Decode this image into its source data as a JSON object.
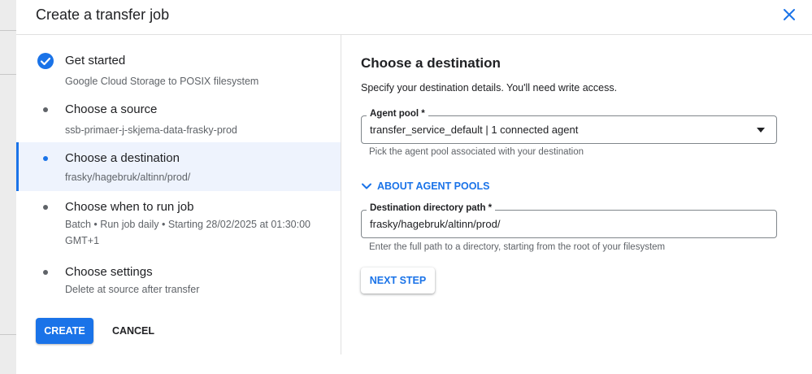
{
  "dialog": {
    "title": "Create a transfer job"
  },
  "steps": [
    {
      "title": "Get started",
      "subtitle": "Google Cloud Storage to POSIX filesystem",
      "state": "completed"
    },
    {
      "title": "Choose a source",
      "subtitle": "ssb-primaer-j-skjema-data-frasky-prod",
      "state": "pending"
    },
    {
      "title": "Choose a destination",
      "subtitle": "frasky/hagebruk/altinn/prod/",
      "state": "active"
    },
    {
      "title": "Choose when to run job",
      "subtitle": "Batch • Run job daily • Starting 28/02/2025 at 01:30:00 GMT+1",
      "state": "pending"
    },
    {
      "title": "Choose settings",
      "subtitle": "Delete at source after transfer",
      "state": "pending"
    }
  ],
  "actions": {
    "create_label": "CREATE",
    "cancel_label": "CANCEL"
  },
  "destination": {
    "heading": "Choose a destination",
    "description": "Specify your destination details. You'll need write access.",
    "agent_pool": {
      "label": "Agent pool *",
      "value": "transfer_service_default | 1 connected agent",
      "hint": "Pick the agent pool associated with your destination"
    },
    "about_label": "ABOUT AGENT POOLS",
    "directory_path": {
      "label": "Destination directory path *",
      "value": "frasky/hagebruk/altinn/prod/",
      "hint": "Enter the full path to a directory, starting from the root of your filesystem"
    },
    "next_label": "NEXT STEP"
  },
  "icons": {
    "close": "close-icon",
    "check": "check-circle-icon",
    "dropdown": "dropdown-arrow-icon",
    "chevron": "chevron-down-icon"
  },
  "colors": {
    "accent": "#1a73e8",
    "active_step_bg": "#eef3fd",
    "text": "#202124",
    "muted": "#5f6368"
  }
}
